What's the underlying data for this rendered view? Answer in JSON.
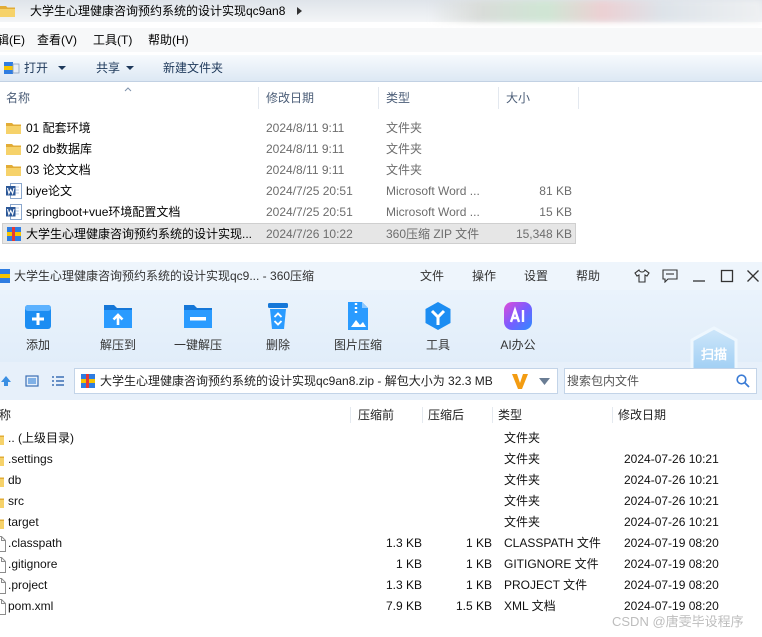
{
  "explorer": {
    "title": "大学生心理健康咨询预约系统的设计实现qc9an8",
    "menu": [
      {
        "label": "辑(E)"
      },
      {
        "label": "查看(V)"
      },
      {
        "label": "工具(T)"
      },
      {
        "label": "帮助(H)"
      }
    ],
    "toolbar": {
      "open_label": "打开",
      "share_label": "共享",
      "new_folder_label": "新建文件夹"
    },
    "columns": {
      "name": "名称",
      "modified": "修改日期",
      "type": "类型",
      "size": "大小"
    },
    "rows": [
      {
        "icon": "folder-icon",
        "name": "01 配套环境",
        "modified": "2024/8/11 9:11",
        "type": "文件夹"
      },
      {
        "icon": "folder-icon",
        "name": "02 db数据库",
        "modified": "2024/8/11 9:11",
        "type": "文件夹"
      },
      {
        "icon": "folder-icon",
        "name": "03 论文文档",
        "modified": "2024/8/11 9:11",
        "type": "文件夹"
      },
      {
        "icon": "word-document-icon",
        "name": "biye论文",
        "modified": "2024/7/25 20:51",
        "type": "Microsoft Word ...",
        "size": "81 KB"
      },
      {
        "icon": "word-document-icon",
        "name": "springboot+vue环境配置文档",
        "modified": "2024/7/25 20:51",
        "type": "Microsoft Word ...",
        "size": "15 KB"
      },
      {
        "icon": "zip-archive-icon",
        "name": "大学生心理健康咨询预约系统的设计实现...",
        "modified": "2024/7/26 10:22",
        "type": "360压缩 ZIP 文件",
        "size": "15,348 KB",
        "selected": true
      }
    ]
  },
  "archiver": {
    "title": "大学生心理健康咨询预约系统的设计实现qc9... - 360压缩",
    "menu": [
      {
        "label": "文件"
      },
      {
        "label": "操作"
      },
      {
        "label": "设置"
      },
      {
        "label": "帮助"
      }
    ],
    "tools": [
      {
        "label": "添加",
        "icon": "add-icon"
      },
      {
        "label": "解压到",
        "icon": "extract-to-icon"
      },
      {
        "label": "一键解压",
        "icon": "one-click-extract-icon"
      },
      {
        "label": "删除",
        "icon": "delete-icon"
      },
      {
        "label": "图片压缩",
        "icon": "image-compress-icon"
      },
      {
        "label": "工具",
        "icon": "tools-icon"
      },
      {
        "label": "AI办公",
        "icon": "ai-office-icon"
      }
    ],
    "scan_label": "扫描",
    "path": "大学生心理健康咨询预约系统的设计实现qc9an8.zip - 解包大小为 32.3 MB",
    "search_placeholder": "搜索包内文件",
    "columns": {
      "name": "称",
      "original_size": "压缩前",
      "compressed_size": "压缩后",
      "type": "类型",
      "modified": "修改日期"
    },
    "rows": [
      {
        "icon": "folder-icon",
        "name": ".. (上级目录)",
        "type": "文件夹"
      },
      {
        "icon": "folder-icon",
        "name": ".settings",
        "type": "文件夹",
        "modified": "2024-07-26 10:21"
      },
      {
        "icon": "folder-icon",
        "name": "db",
        "type": "文件夹",
        "modified": "2024-07-26 10:21"
      },
      {
        "icon": "folder-icon",
        "name": "src",
        "type": "文件夹",
        "modified": "2024-07-26 10:21"
      },
      {
        "icon": "folder-icon",
        "name": "target",
        "type": "文件夹",
        "modified": "2024-07-26 10:21"
      },
      {
        "icon": "file-icon",
        "name": ".classpath",
        "original_size": "1.3 KB",
        "compressed_size": "1 KB",
        "type": "CLASSPATH 文件",
        "modified": "2024-07-19 08:20"
      },
      {
        "icon": "file-icon",
        "name": ".gitignore",
        "original_size": "1 KB",
        "compressed_size": "1 KB",
        "type": "GITIGNORE 文件",
        "modified": "2024-07-19 08:20"
      },
      {
        "icon": "file-icon",
        "name": ".project",
        "original_size": "1.3 KB",
        "compressed_size": "1 KB",
        "type": "PROJECT 文件",
        "modified": "2024-07-19 08:20"
      },
      {
        "icon": "file-icon",
        "name": "pom.xml",
        "original_size": "7.9 KB",
        "compressed_size": "1.5 KB",
        "type": "XML 文档",
        "modified": "2024-07-19 08:20"
      }
    ]
  },
  "watermark": "CSDN @唐雯毕设程序",
  "colors": {
    "accent": "#1c8df2",
    "folder": "#f3c54a",
    "selection": "#e6e6e6"
  }
}
